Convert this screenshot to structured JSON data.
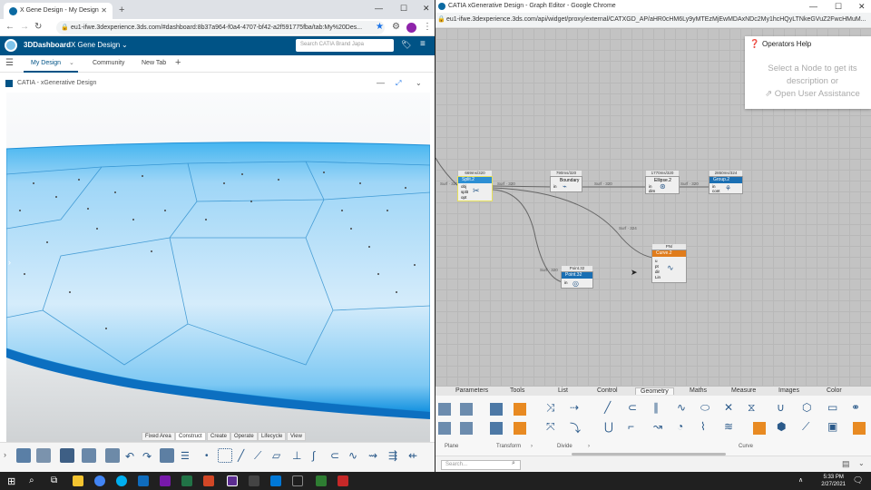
{
  "left": {
    "tab_title": "X Gene Design - My Design",
    "url": "eu1-ifwe.3dexperience.3ds.com/#dashboard:8b37a964-f0a4-4707-bf42-a2f591775fba/tab:My%20Des...",
    "brand": "3DDashboard",
    "dashboard_name": "X Gene Design",
    "search_placeholder": "Search CATIA Brand Japa",
    "tabs": [
      "My Design",
      "Community",
      "New Tab"
    ],
    "widget_title": "CATIA - xGenerative Design",
    "ptabs": [
      "Fixed Area",
      "Construct",
      "Create",
      "Operate",
      "Lifecycle",
      "View"
    ],
    "active_ptab": "Construct"
  },
  "right": {
    "window_title": "CATIA xGenerative Design - Graph Editor - Google Chrome",
    "url": "eu1-ifwe.3dexperience.3ds.com/api/widget/proxy/external/CATXGD_AP/aHR0cHM6Ly9yMTEzMjEwMDAxNDc2My1hcHQyLTNkeGVuZ2FwcHMuM...",
    "help": {
      "title": "Operators Help",
      "line1": "Select a Node to get its",
      "line2": "description or",
      "link": "Open User Assistance"
    },
    "nodes": [
      {
        "label": "669ms/320",
        "name": "Split.2",
        "ports": [
          "obj",
          "split",
          "opt"
        ],
        "color": "#2d8fd4"
      },
      {
        "label": "790ms/320",
        "name": "Boundary",
        "ports": [
          "in"
        ],
        "color": "#eeeeee"
      },
      {
        "label": "1770ms/320",
        "name": "Ellipse.2",
        "ports": [
          "in",
          "dim"
        ],
        "color": "#eeeeee"
      },
      {
        "label": "2850ms/324",
        "name": "Group.2",
        "ports": [
          "in",
          "cont"
        ],
        "color": "#1a6fb3"
      },
      {
        "label": "Point.32",
        "name": "Point.32",
        "ports": [
          "in"
        ],
        "color": "#1a6fb3"
      },
      {
        "label": "PN/",
        "name": "Curve.2",
        "ports": [
          "u",
          "pt",
          "dir",
          "Lin"
        ],
        "color": "#e07c1c"
      }
    ],
    "wire_labels": [
      "Surf · 320",
      "Surf · 320",
      "Surf · 320",
      "Surf · 324",
      "Surf · 320",
      "Surf · 320"
    ],
    "categories": [
      "Parameters",
      "Tools",
      "List",
      "Control",
      "Geometry",
      "Maths",
      "Measure",
      "Images",
      "Color"
    ],
    "active_category": "Geometry",
    "palette_groups": [
      "Plane",
      "Transform",
      "Divide",
      "Curve"
    ],
    "search_placeholder": "Search..."
  },
  "taskbar": {
    "time": "5:33 PM",
    "date": "2/27/2021"
  }
}
